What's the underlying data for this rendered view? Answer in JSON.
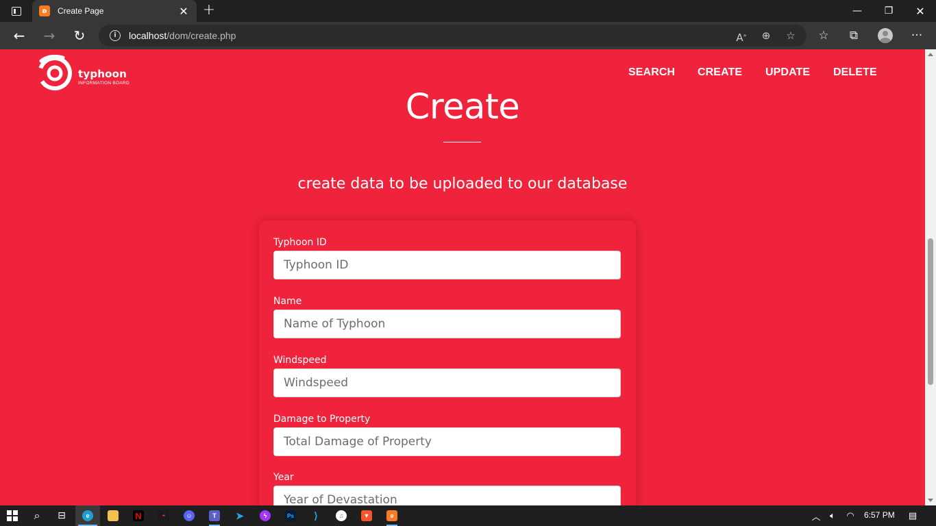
{
  "browser": {
    "tab_title": "Create Page",
    "address": {
      "host": "localhost",
      "path": "/dom/create.php"
    },
    "icons": {
      "tab_actions": "tab-actions-icon",
      "favicon": "xampp-icon",
      "tab_close": "close-icon",
      "new_tab": "plus-icon",
      "back": "arrow-left-icon",
      "forward": "arrow-right-icon",
      "refresh": "refresh-icon",
      "site_info": "info-icon",
      "read_aloud": "read-aloud-icon",
      "zoom": "zoom-icon",
      "add_favorite": "star-plus-icon",
      "favorites": "favorites-icon",
      "collections": "collections-icon",
      "profile": "profile-icon",
      "more": "more-icon"
    }
  },
  "site": {
    "brand": "typhoon",
    "brand_sub": "INFORMATION BOARD",
    "nav": [
      "SEARCH",
      "CREATE",
      "UPDATE",
      "DELETE"
    ],
    "accent_color": "#ef233c"
  },
  "page": {
    "title": "Create",
    "subtitle": "create data to be uploaded to our database"
  },
  "form": {
    "fields": [
      {
        "label": "Typhoon ID",
        "placeholder": "Typhoon ID"
      },
      {
        "label": "Name",
        "placeholder": "Name of Typhoon"
      },
      {
        "label": "Windspeed",
        "placeholder": "Windspeed"
      },
      {
        "label": "Damage to Property",
        "placeholder": "Total Damage of Property"
      },
      {
        "label": "Year",
        "placeholder": "Year of Devastation"
      }
    ]
  },
  "taskbar": {
    "apps": [
      "windows-start-icon",
      "search-icon",
      "task-view-icon",
      "edge-icon",
      "file-explorer-icon",
      "netflix-icon",
      "garena-icon",
      "discord-icon",
      "teams-icon",
      "telegram-icon",
      "messenger-icon",
      "photoshop-icon",
      "vscode-icon",
      "itunes-icon",
      "brave-icon",
      "xampp-icon"
    ],
    "clock": "6:57 PM"
  }
}
